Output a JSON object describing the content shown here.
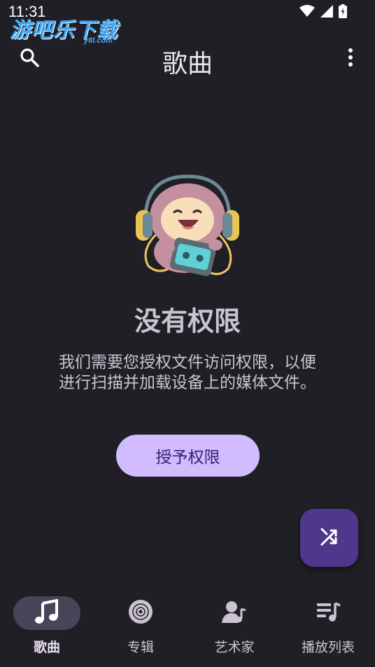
{
  "status_bar": {
    "time": "11:31"
  },
  "watermark": {
    "text": "游吧乐下载",
    "sub": "y8l.com"
  },
  "header": {
    "title": "歌曲",
    "search_icon": "search-icon",
    "more_icon": "more-vert-icon"
  },
  "empty_state": {
    "title": "没有权限",
    "description": "我们需要您授权文件访问权限，以便进行扫描并加载设备上的媒体文件。",
    "button_label": "授予权限"
  },
  "fab": {
    "icon": "shuffle-icon"
  },
  "bottom_nav": {
    "items": [
      {
        "label": "歌曲",
        "icon": "music-note-icon",
        "active": true
      },
      {
        "label": "专辑",
        "icon": "album-icon",
        "active": false
      },
      {
        "label": "艺术家",
        "icon": "artist-icon",
        "active": false
      },
      {
        "label": "播放列表",
        "icon": "playlist-icon",
        "active": false
      }
    ]
  },
  "colors": {
    "background": "#211f26",
    "primary_button": "#d0bcff",
    "fab": "#4f378b",
    "active_nav": "#4a4458"
  }
}
